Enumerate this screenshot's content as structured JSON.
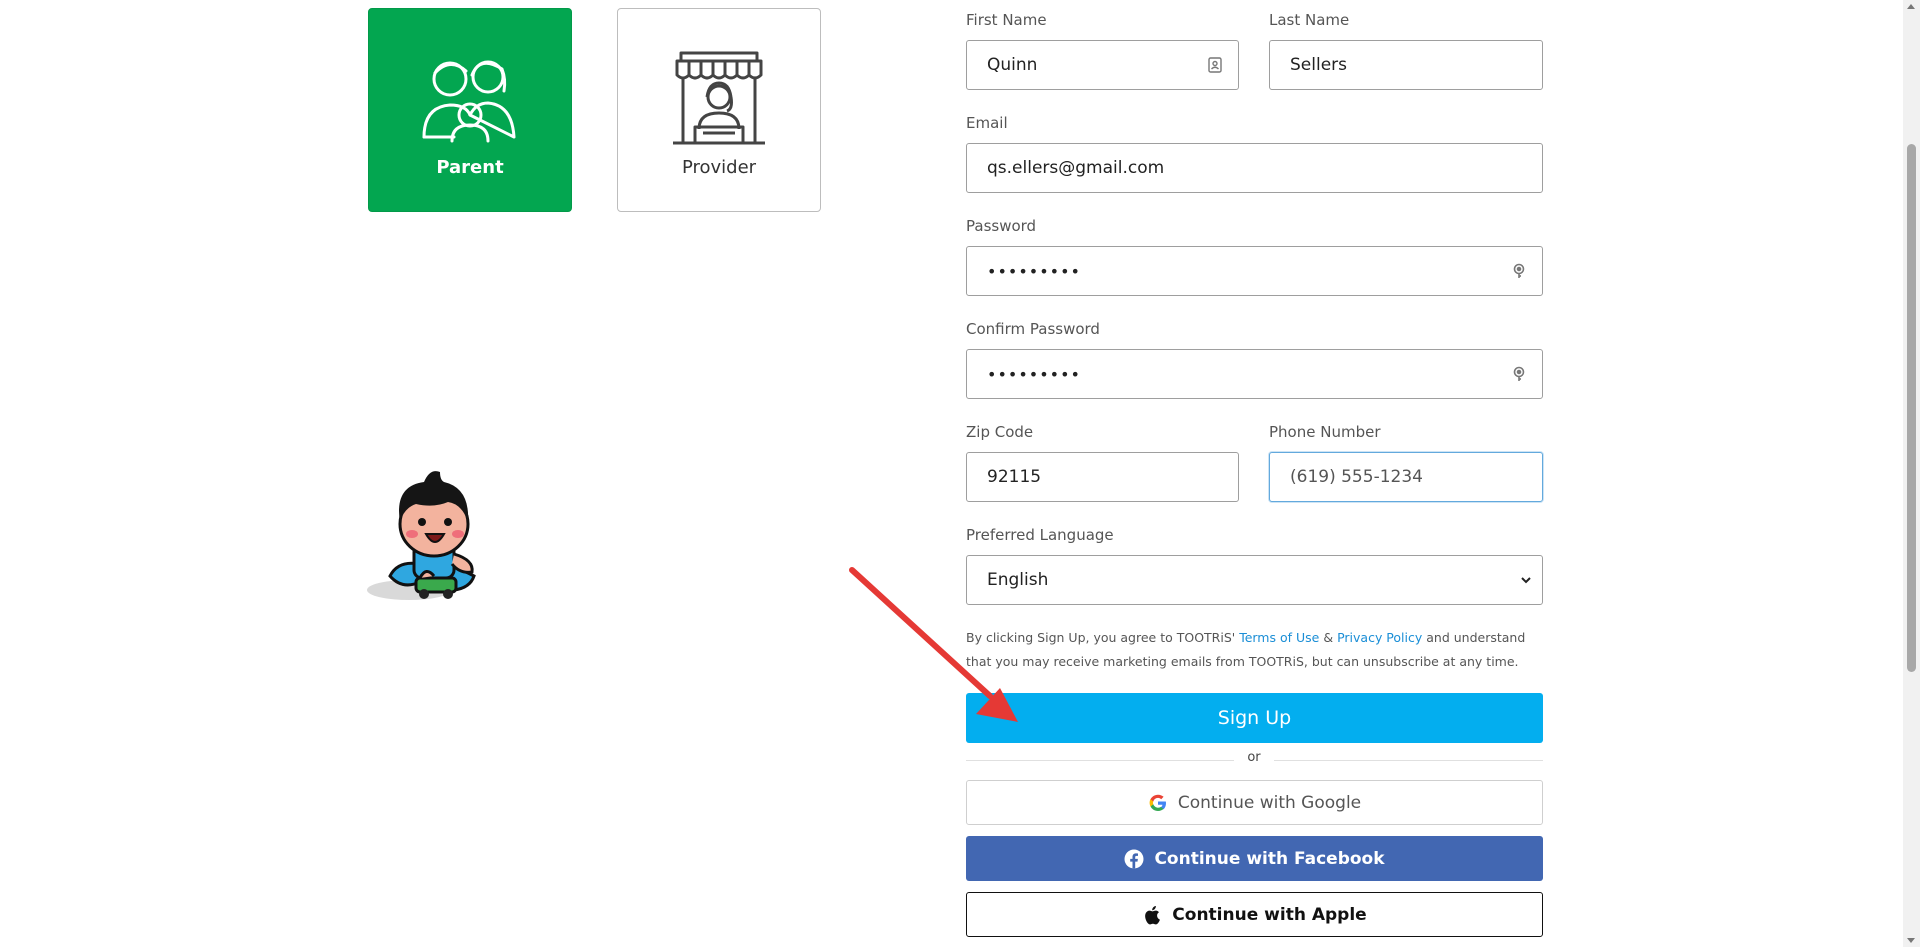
{
  "roles": {
    "parent_label": "Parent",
    "provider_label": "Provider",
    "selected": "Parent",
    "selected_color": "#03a650"
  },
  "form": {
    "first_name": {
      "label": "First Name",
      "value": "Quinn"
    },
    "last_name": {
      "label": "Last Name",
      "value": "Sellers"
    },
    "email": {
      "label": "Email",
      "value": "qs.ellers@gmail.com"
    },
    "password": {
      "label": "Password",
      "value": "•••••••••"
    },
    "confirm_password": {
      "label": "Confirm Password",
      "value": "•••••••••"
    },
    "zip_code": {
      "label": "Zip Code",
      "value": "92115"
    },
    "phone": {
      "label": "Phone Number",
      "placeholder": "(619) 555-1234"
    },
    "language": {
      "label": "Preferred Language",
      "value": "English"
    }
  },
  "legal": {
    "prefix": "By clicking Sign Up, you agree to TOOTRiS'",
    "terms_link": "Terms of Use",
    "amp": "&",
    "privacy_link": "Privacy Policy",
    "suffix": "and understand that you may receive marketing emails from TOOTRiS, but can unsubscribe at any time."
  },
  "actions": {
    "signup_label": "Sign Up",
    "or_label": "or",
    "google_label": "Continue with Google",
    "facebook_label": "Continue with Facebook",
    "apple_label": "Continue with Apple"
  },
  "colors": {
    "signup": "#03aeef",
    "facebook": "#4267b2",
    "annotation_arrow": "#e53935"
  }
}
